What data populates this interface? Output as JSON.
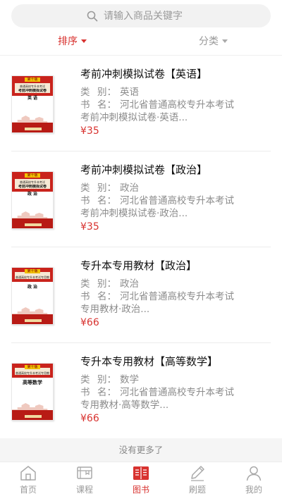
{
  "search": {
    "placeholder": "请输入商品关键字"
  },
  "filters": {
    "sort_label": "排序",
    "category_label": "分类"
  },
  "products": [
    {
      "title": "考前冲刺模拟试卷【英语】",
      "category_key": "类",
      "category_key2": "别：",
      "category": "英语",
      "name_key": "书",
      "name_key2": "名：",
      "name_line1": "河北省普通高校专升本考试",
      "name_line2": "考前冲刺模拟试卷·英语...",
      "price": "¥35",
      "cover": {
        "tag": "第十版",
        "line1": "普通高校专升本考试",
        "line2": "考前冲刺模拟试卷",
        "subject": "英 语"
      }
    },
    {
      "title": "考前冲刺模拟试卷【政治】",
      "category_key": "类",
      "category_key2": "别：",
      "category": "政治",
      "name_key": "书",
      "name_key2": "名：",
      "name_line1": "河北省普通高校专升本考试",
      "name_line2": "考前冲刺模拟试卷·政治...",
      "price": "¥35",
      "cover": {
        "tag": "第十版",
        "line1": "普通高校专升本考试",
        "line2": "考前冲刺模拟试卷",
        "subject": "政 治"
      }
    },
    {
      "title": "专升本专用教材【政治】",
      "category_key": "类",
      "category_key2": "别：",
      "category": "政治",
      "name_key": "书",
      "name_key2": "名：",
      "name_line1": "河北省普通高校专升本考试",
      "name_line2": "专用教材·政治...",
      "price": "¥66",
      "cover": {
        "tag": "第十版",
        "line1": "普通高校专升本考试专用教材",
        "line2": "",
        "subject": "政 治"
      }
    },
    {
      "title": "专升本专用教材【高等数学】",
      "category_key": "类",
      "category_key2": "别：",
      "category": "数学",
      "name_key": "书",
      "name_key2": "名：",
      "name_line1": "河北省普通高校专升本考试",
      "name_line2": "专用教材·高等数学...",
      "price": "¥66",
      "cover": {
        "tag": "第十版",
        "line1": "普通高校专升本考试专用教材",
        "line2": "",
        "subject": "高等数学"
      }
    }
  ],
  "no_more": "没有更多了",
  "tabs": [
    {
      "label": "首页",
      "icon": "home-icon"
    },
    {
      "label": "课程",
      "icon": "course-icon"
    },
    {
      "label": "图书",
      "icon": "book-icon",
      "active": true
    },
    {
      "label": "刷题",
      "icon": "pencil-icon"
    },
    {
      "label": "我的",
      "icon": "user-icon"
    }
  ],
  "colors": {
    "accent": "#d8322f",
    "muted": "#999999"
  }
}
